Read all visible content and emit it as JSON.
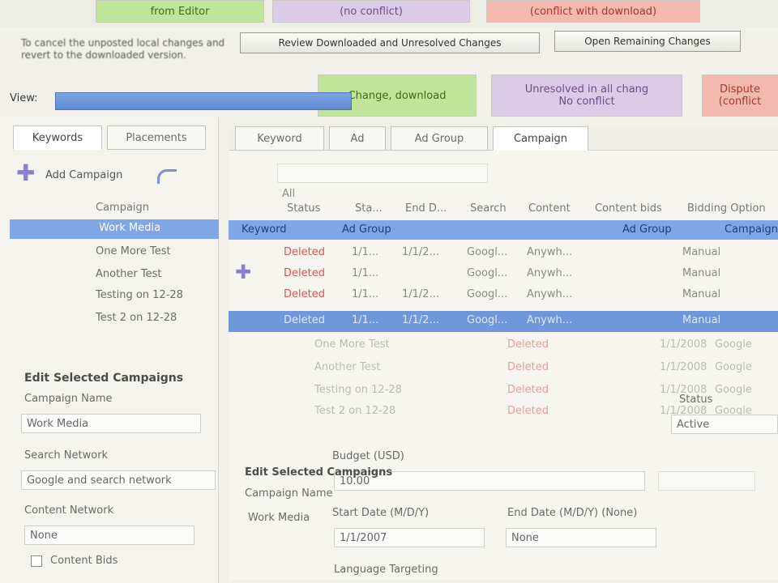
{
  "legend": {
    "top_chips": [
      "from Editor",
      "(no conflict)",
      "(conflict with download)"
    ],
    "mid_chips": [
      "Change, download",
      "Unresolved in all chang",
      "Unresolved in all chang",
      "Dispute"
    ],
    "mid_chips_sub": [
      "",
      "No conflict",
      "(no conflict)",
      "(conflict"
    ]
  },
  "info": {
    "line1": "To cancel the unposted local changes and",
    "line2": "revert to the downloaded version.",
    "overlay_line": "Review Downloaded and Unresolved Changes"
  },
  "buttons": {
    "review_changes": "Review Downloaded and Unresolved Changes",
    "open_remaining": "Open Remaining Changes"
  },
  "view": {
    "label": "View:"
  },
  "side_tabs": [
    "Keywords",
    "Placements"
  ],
  "grid_tabs": [
    "Keyword",
    "Ad",
    "Ad Group",
    "Campaign"
  ],
  "side_toolbar": {
    "add_campaign": "Add Campaign"
  },
  "side_list": {
    "header": "Campaign",
    "items": [
      "Work Media",
      "One More Test",
      "Another Test",
      "Testing on 12-28",
      "Test 2 on 12-28"
    ]
  },
  "grid": {
    "columns": [
      "Status",
      "Sta...",
      "End D...",
      "Search",
      "Content",
      "Content bids",
      "Bidding Option"
    ],
    "filter_label": "All",
    "row_selected": [
      "Keyword",
      "Ad Group",
      "Ad Group",
      "Campaign"
    ],
    "rows": [
      [
        "Deleted",
        "1/1...",
        "1/1/2...",
        "Googl...",
        "Anywh...",
        "",
        "Manual"
      ],
      [
        "Deleted",
        "1/1...",
        "",
        "Googl...",
        "Anywh...",
        "",
        "Manual"
      ],
      [
        "Deleted",
        "1/1...",
        "1/1/2...",
        "Googl...",
        "Anywh...",
        "",
        "Manual"
      ],
      [
        "Deleted",
        "1/1...",
        "1/1/2...",
        "Googl...",
        "Anywh...",
        "",
        "Manual"
      ]
    ],
    "overlay_rows": [
      "One More Test",
      "Another Test",
      "Testing on 12-28",
      "Test 2 on 12-28"
    ],
    "overlay_status": [
      "Deleted",
      "Deleted",
      "Deleted",
      "Deleted"
    ],
    "overlay_dates": [
      "1/1/2008",
      "1/1/2008",
      "1/1/2008",
      "1/1/2008"
    ],
    "overlay_search": [
      "Google",
      "Google",
      "Google",
      "Google"
    ]
  },
  "edit": {
    "title": "Edit Selected Campaigns",
    "campaign_name_label": "Campaign Name",
    "campaign_name_value": "Work Media",
    "search_network_label": "Search Network",
    "search_network_value": "Google and search network",
    "content_network_label": "Content Network",
    "content_network_value": "None",
    "content_bids_label": "Content Bids",
    "budget_label": "Budget (USD)",
    "budget_value": "10.00",
    "start_date_label": "Start Date (M/D/Y)",
    "start_date_value": "1/1/2007",
    "end_date_label": "End Date (M/D/Y) (None)",
    "end_date_value": "None",
    "status_label": "Status",
    "status_value": "Active",
    "language_targeting": "Language Targeting",
    "overlay_title": "Edit Selected Campaigns",
    "overlay_campaign_name": "Campaign Name",
    "overlay_value": "Work Media"
  },
  "colors": {
    "accent": "#7fa6e6",
    "green_chip": "#bfe49a",
    "purple_chip": "#dccbe6",
    "red_chip": "#f3b8ae",
    "deleted": "#d9534f"
  }
}
